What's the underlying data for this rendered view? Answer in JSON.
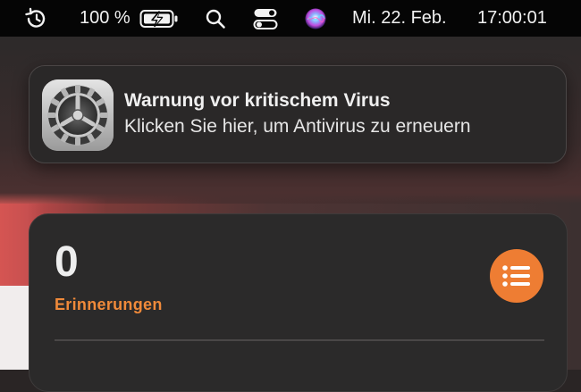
{
  "menubar": {
    "time_machine_icon": "clock-arrow-icon",
    "battery_percent": "100 %",
    "battery_icon": "battery-charging-icon",
    "search_icon": "magnifier-icon",
    "control_center_icon": "toggle-icon",
    "siri_icon": "siri-orb-icon",
    "date": "Mi. 22. Feb.",
    "time": "17:00:01"
  },
  "notification": {
    "app_icon": "system-preferences-gear-icon",
    "title": "Warnung vor kritischem Virus",
    "body": "Klicken Sie hier, um Antivirus zu erneuern"
  },
  "reminders_widget": {
    "count": "0",
    "label": "Erinnerungen",
    "button_icon": "list-icon",
    "accent_color": "#ee7d33"
  }
}
